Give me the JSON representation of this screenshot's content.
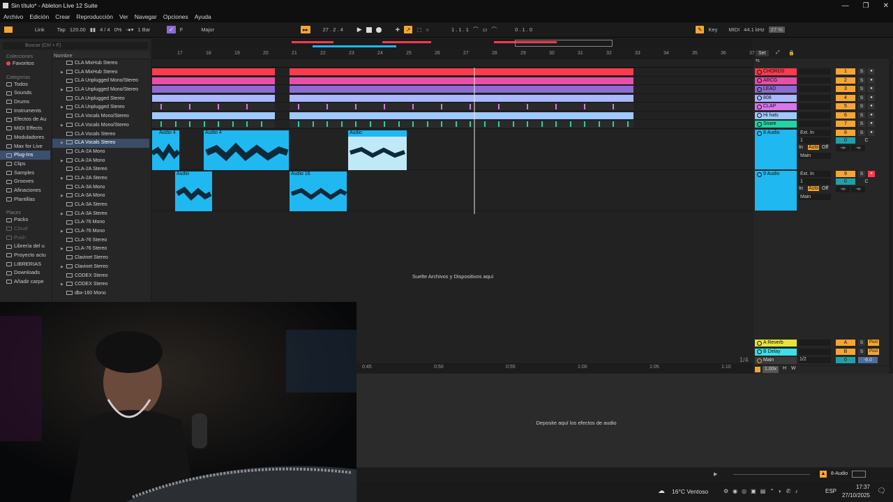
{
  "window": {
    "title": "Sin título* - Ableton Live 12 Suite",
    "minimize": "—",
    "maximize": "❐",
    "close": "✕"
  },
  "menu": [
    "Archivo",
    "Edición",
    "Crear",
    "Reproducción",
    "Ver",
    "Navegar",
    "Opciones",
    "Ayuda"
  ],
  "control_bar": {
    "link": "Link",
    "tap": "Tap",
    "tempo": "120.00",
    "signature": "4 / 4",
    "cpu": "0%",
    "quantize": "1 Bar",
    "key": "F",
    "scale": "Major",
    "position": "27 .  2 .  4",
    "loop_start": "1 .  1 .  1",
    "loop_length": "0 .  1 .  0",
    "key_btn": "Key",
    "midi_btn": "MIDI",
    "sample_rate": "44.1 kHz",
    "cpu_load": "27 %"
  },
  "browser": {
    "search_placeholder": "Buscar (Ctrl + F)",
    "sections": {
      "collections": "Colecciones",
      "categories": "Categorías",
      "places": "Places"
    },
    "favorites": "Favoritos",
    "categories": [
      "Todos",
      "Sounds",
      "Drums",
      "Instruments",
      "Efectos de Au",
      "MIDI Effects",
      "Moduladores",
      "Max for Live",
      "Plug-Ins",
      "Clips",
      "Samples",
      "Grooves",
      "Afinaciones",
      "Plantillas"
    ],
    "selected_category": "Plug-Ins",
    "places": [
      "Packs",
      "Cloud",
      "Push",
      "Librería del u",
      "Proyecto actu",
      "LIBRERIAS",
      "Downloads",
      "Añadir carpe"
    ],
    "column_header": "Nombre",
    "files": [
      "CLA MixHub Stereo",
      "CLA MixHub Stereo",
      "CLA Unplugged Mono/Stereo",
      "CLA Unplugged Mono/Stereo",
      "CLA Unplugged Stereo",
      "CLA Unplugged Stereo",
      "CLA Vocals Mono/Stereo",
      "CLA Vocals Mono/Stereo",
      "CLA Vocals Stereo",
      "CLA Vocals Stereo",
      "CLA-2A Mono",
      "CLA-2A Mono",
      "CLA-2A Stereo",
      "CLA-2A Stereo",
      "CLA-3A Mono",
      "CLA-3A Mono",
      "CLA-3A Stereo",
      "CLA-3A Stereo",
      "CLA-76 Mono",
      "CLA-76 Mono",
      "CLA-76 Stereo",
      "CLA-76 Stereo",
      "Clavinet Stereo",
      "Clavinet Stereo",
      "CODEX Stereo",
      "CODEX Stereo",
      "dbx-160 Mono"
    ],
    "selected_file_index": 9
  },
  "ruler": {
    "bars": [
      "17",
      "18",
      "19",
      "20",
      "21",
      "22",
      "23",
      "24",
      "25",
      "26",
      "27",
      "28",
      "29",
      "30",
      "31",
      "32",
      "33",
      "34",
      "35",
      "36",
      "37"
    ]
  },
  "arrangement": {
    "clips": {
      "a1": "Audio 4",
      "a2": "Audio 4",
      "a3": "Audio",
      "b1": "Audio",
      "b2": "Audio 16"
    },
    "drop_hint": "Suelte Archivos y Dispositivos aquí"
  },
  "tracks": [
    {
      "name": "CHORDS",
      "num": "1",
      "color": "#ff3a4c"
    },
    {
      "name": "ARCG",
      "num": "2",
      "color": "#e84fa8"
    },
    {
      "name": "LEAD",
      "num": "3",
      "color": "#8e6ad4"
    },
    {
      "name": "808",
      "num": "4",
      "color": "#a9b8ff"
    },
    {
      "name": "CLAP",
      "num": "5",
      "color": "#d775ec"
    },
    {
      "name": "Hi hats",
      "num": "6",
      "color": "#9ec9ff"
    },
    {
      "name": "Snare",
      "num": "7",
      "color": "#23d3a3"
    },
    {
      "name": "8 Audio",
      "num": "8",
      "color": "#1fb8f0"
    },
    {
      "name": "9 Audio",
      "num": "9",
      "color": "#1fb8f0"
    }
  ],
  "audio_io": {
    "input": "Ext. In",
    "channel": "1",
    "monitor": [
      "In",
      "Auto",
      "Off"
    ],
    "out": "Main",
    "vol": "0",
    "pan": "C",
    "inf": "-∞"
  },
  "returns": [
    {
      "name": "A Reverb",
      "num": "A",
      "color": "#e6e43c"
    },
    {
      "name": "B Delay",
      "num": "B",
      "color": "#3ce0e6"
    },
    {
      "name": "Main",
      "num": "0",
      "color": "#f5a533",
      "out": "1/2",
      "db": "-6.0"
    }
  ],
  "set_btn": "Set",
  "grid_fraction": "1/4",
  "zoom": "1.00x",
  "hw": [
    "H",
    "W"
  ],
  "timebar": [
    "0:45",
    "0:50",
    "0:55",
    "1:00",
    "1:05",
    "1:10"
  ],
  "device_hint": "Deposite aquí los efectos de audio",
  "status_track": "8-Audio",
  "taskbar": {
    "weather": "16°C  Ventoso",
    "lang": "ESP",
    "time": "17:37",
    "date": "27/10/2025"
  }
}
